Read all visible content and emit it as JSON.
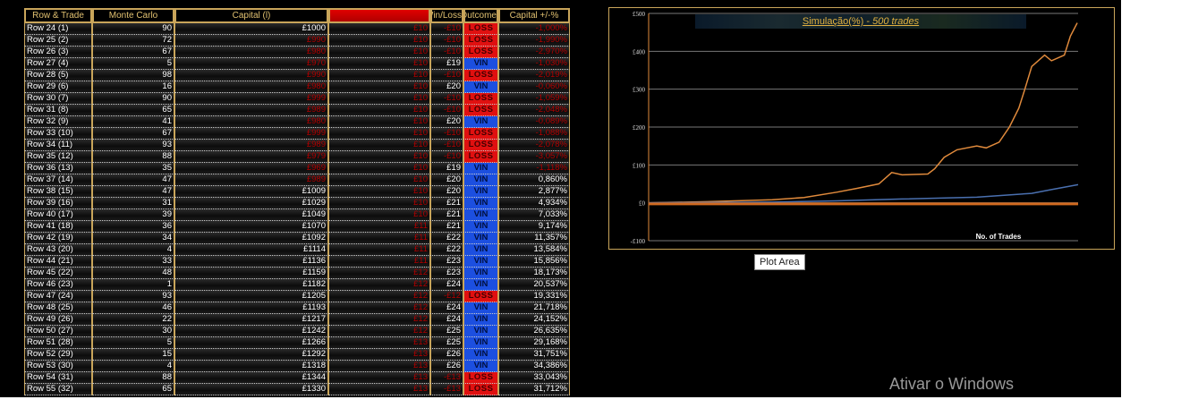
{
  "headers": [
    "Row & Trade",
    "Monte Carlo",
    "Capital (£)",
    "",
    "Win/Loss",
    "Outcome",
    "Capital +/-%"
  ],
  "header_visible": [
    "Row & Trade",
    "Monte Carlo",
    "Capital (l)",
    "",
    "in/Loss",
    "utcome",
    "Capital +/-%"
  ],
  "rows": [
    [
      "Row 24 (1)",
      "90",
      "£1000",
      "£10",
      "-£10",
      "LOSS",
      "-1,000%"
    ],
    [
      "Row 25 (2)",
      "72",
      "£990",
      "£10",
      "-£10",
      "LOSS",
      "-1,990%"
    ],
    [
      "Row 26 (3)",
      "67",
      "£980",
      "£10",
      "-£10",
      "LOSS",
      "-2,970%"
    ],
    [
      "Row 27 (4)",
      "5",
      "£970",
      "£10",
      "£19",
      "VIN",
      "-1,030%"
    ],
    [
      "Row 28 (5)",
      "98",
      "£990",
      "£10",
      "-£10",
      "LOSS",
      "-2,019%"
    ],
    [
      "Row 29 (6)",
      "16",
      "£980",
      "£10",
      "£20",
      "VIN",
      "-0,060%"
    ],
    [
      "Row 30 (7)",
      "90",
      "£999",
      "£10",
      "-£10",
      "LOSS",
      "-1,059%"
    ],
    [
      "Row 31 (8)",
      "65",
      "£989",
      "£10",
      "-£10",
      "LOSS",
      "-2,048%"
    ],
    [
      "Row 32 (9)",
      "41",
      "£980",
      "£10",
      "£20",
      "VIN",
      "-0,089%"
    ],
    [
      "Row 33 (10)",
      "67",
      "£999",
      "£10",
      "-£10",
      "LOSS",
      "-1,088%"
    ],
    [
      "Row 34 (11)",
      "93",
      "£989",
      "£10",
      "-£10",
      "LOSS",
      "-2,078%"
    ],
    [
      "Row 35 (12)",
      "88",
      "£979",
      "£10",
      "-£10",
      "LOSS",
      "-3,057%"
    ],
    [
      "Row 36 (13)",
      "35",
      "£969",
      "£10",
      "£19",
      "VIN",
      "-1,118%"
    ],
    [
      "Row 37 (14)",
      "47",
      "£989",
      "£10",
      "£20",
      "VIN",
      "0,860%"
    ],
    [
      "Row 38 (15)",
      "47",
      "£1009",
      "£10",
      "£20",
      "VIN",
      "2,877%"
    ],
    [
      "Row 39 (16)",
      "31",
      "£1029",
      "£10",
      "£21",
      "VIN",
      "4,934%"
    ],
    [
      "Row 40 (17)",
      "39",
      "£1049",
      "£10",
      "£21",
      "VIN",
      "7,033%"
    ],
    [
      "Row 41 (18)",
      "36",
      "£1070",
      "£11",
      "£21",
      "VIN",
      "9,174%"
    ],
    [
      "Row 42 (19)",
      "34",
      "£1092",
      "£11",
      "£22",
      "VIN",
      "11,357%"
    ],
    [
      "Row 43 (20)",
      "4",
      "£1114",
      "£11",
      "£22",
      "VIN",
      "13,584%"
    ],
    [
      "Row 44 (21)",
      "33",
      "£1136",
      "£11",
      "£23",
      "VIN",
      "15,856%"
    ],
    [
      "Row 45 (22)",
      "48",
      "£1159",
      "£12",
      "£23",
      "VIN",
      "18,173%"
    ],
    [
      "Row 46 (23)",
      "1",
      "£1182",
      "£12",
      "£24",
      "VIN",
      "20,537%"
    ],
    [
      "Row 47 (24)",
      "93",
      "£1205",
      "£12",
      "-£12",
      "LOSS",
      "19,331%"
    ],
    [
      "Row 48 (25)",
      "46",
      "£1193",
      "£12",
      "£24",
      "VIN",
      "21,718%"
    ],
    [
      "Row 49 (26)",
      "22",
      "£1217",
      "£12",
      "£24",
      "VIN",
      "24,152%"
    ],
    [
      "Row 50 (27)",
      "30",
      "£1242",
      "£12",
      "£25",
      "VIN",
      "26,635%"
    ],
    [
      "Row 51 (28)",
      "5",
      "£1266",
      "£13",
      "£25",
      "VIN",
      "29,168%"
    ],
    [
      "Row 52 (29)",
      "15",
      "£1292",
      "£13",
      "£26",
      "VIN",
      "31,751%"
    ],
    [
      "Row 53 (30)",
      "4",
      "£1318",
      "£13",
      "£26",
      "VIN",
      "34,386%"
    ],
    [
      "Row 54 (31)",
      "88",
      "£1344",
      "£13",
      "-£13",
      "LOSS",
      "33,043%"
    ],
    [
      "Row 55 (32)",
      "65",
      "£1330",
      "£13",
      "-£13",
      "LOSS",
      "31,712%"
    ]
  ],
  "colors": {
    "loss": "#e01010",
    "win": "#1c4fe0",
    "negative_text": "#b00000",
    "orange": "#e08a3c",
    "blue": "#4a70b0",
    "frame": "#c9a55a"
  },
  "chart_data": {
    "type": "line",
    "title": "Simulação(%)  -  500 trades",
    "title_plain": "Simulação(%)  - ",
    "title_italic": "500 trades",
    "xlabel": "No. of Trades",
    "ylabel": "",
    "yticks": [
      "£500",
      "£400",
      "£300",
      "£200",
      "£100",
      "£0",
      "-£100"
    ],
    "ylim": [
      -100,
      500
    ],
    "xlim": [
      0,
      500
    ],
    "grid": true,
    "series": [
      {
        "color": "#e08a3c",
        "x": [
          0,
          68,
          144,
          181,
          219,
          242,
          268,
          283,
          295,
          325,
          333,
          344,
          359,
          382,
          393,
          408,
          420,
          431,
          438,
          446,
          461,
          469,
          484,
          491,
          499
        ],
        "y": [
          0,
          3,
          8,
          14,
          28,
          38,
          50,
          80,
          74,
          76,
          90,
          120,
          140,
          150,
          145,
          160,
          200,
          250,
          300,
          360,
          390,
          375,
          390,
          440,
          475
        ]
      },
      {
        "color": "#4a70b0",
        "x": [
          0,
          144,
          219,
          295,
          382,
          446,
          469,
          500
        ],
        "y": [
          0,
          2,
          5,
          10,
          15,
          25,
          35,
          48
        ]
      },
      {
        "color": "#d06a20",
        "x": [
          0,
          500
        ],
        "y": [
          -3,
          -3
        ]
      }
    ]
  },
  "tooltip": "Plot Area",
  "watermark": "Ativar o Windows"
}
